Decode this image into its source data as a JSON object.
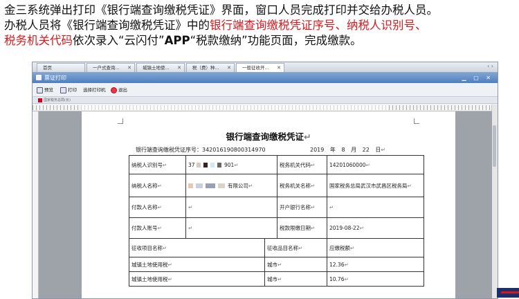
{
  "caption": {
    "line1": "金三系统弹出打印《银行端查询缴税凭证》界面，窗口人员完成打印并交给办税人员。",
    "line2_pre": "办税人员将《银行端查询缴税凭证》中的",
    "line2_red": "银行端查询缴税凭证序号、纳税人识别号、",
    "line3_red": "税务机关代码",
    "line3_mid": "依次录入“云闪付”",
    "line3_app": "APP",
    "line3_post": "“税款缴纳”功能页面，完成缴款。"
  },
  "tabs": [
    {
      "label": "首页"
    },
    {
      "label": "一户式查询..."
    },
    {
      "label": "城镇土地使..."
    },
    {
      "label": "税（费）种..."
    },
    {
      "label": "一般征收开..."
    }
  ],
  "dialog": {
    "title": "票证打印",
    "toolbar": {
      "preview": "预览",
      "print": "打印",
      "choose_printer": "选择打印机",
      "exit": "退出"
    },
    "docbar": "国家税务总局(长)"
  },
  "voucher": {
    "title": "银行端查询缴税凭证",
    "serial_label": "银行端查询缴税凭证序号：",
    "serial_value": "342016190800314970",
    "date_year": "2019",
    "date_year_unit": "年",
    "date_month": "8",
    "date_month_unit": "月",
    "date_day": "22",
    "date_day_unit": "日",
    "para": "↵",
    "rows": {
      "taxpayer_id_label": "纳税人识别号",
      "taxpayer_id_prefix": "37",
      "taxpayer_id_suffix": "901",
      "tax_office_code_label": "税务机关代码",
      "tax_office_code": "14201060000",
      "taxpayer_name_label": "纳税人名称",
      "taxpayer_name_suffix": "有限公司",
      "tax_office_name_label": "税务机关名称",
      "tax_office_name": "国家税务总局武汉市武昌区税务局",
      "payer_name_label": "付款人名称",
      "bank_label": "开户银行名称",
      "payer_account_label": "付款人账号",
      "deadline_label": "税款限缴日期",
      "deadline": "2019-08-22",
      "item_header": "征收项目名称",
      "subitem_header": "征收品目名称",
      "amount_header": "应缴税额"
    },
    "items": [
      {
        "item": "城镇土地使用税",
        "subitem": "城市",
        "amount": "12.36"
      },
      {
        "item": "城镇土地使用税",
        "subitem": "城市",
        "amount": "10.76"
      }
    ]
  },
  "colors": {
    "highlight": "#d9191e",
    "titlebar": "#5a86c4"
  }
}
